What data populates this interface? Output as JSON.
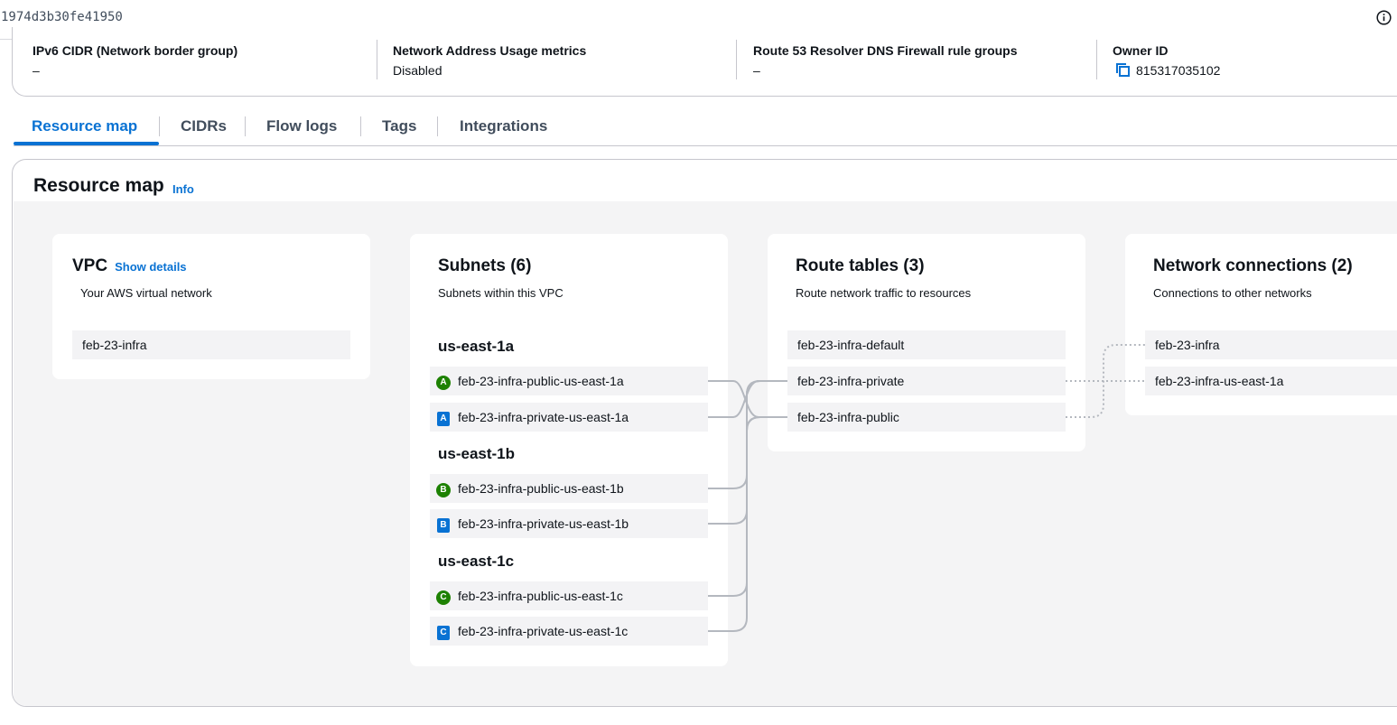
{
  "header": {
    "vpc_id": "1974d3b30fe41950"
  },
  "details": [
    {
      "key": "IPv6 CIDR (Network border group)",
      "value": "–"
    },
    {
      "key": "Network Address Usage metrics",
      "value": "Disabled"
    },
    {
      "key": "Route 53 Resolver DNS Firewall rule groups",
      "value": "–"
    },
    {
      "key": "Owner ID",
      "value": "815317035102"
    }
  ],
  "tabs": [
    {
      "label": "Resource map",
      "active": true
    },
    {
      "label": "CIDRs"
    },
    {
      "label": "Flow logs"
    },
    {
      "label": "Tags"
    },
    {
      "label": "Integrations"
    }
  ],
  "resource_map": {
    "title": "Resource map",
    "info": "Info",
    "vpc": {
      "title": "VPC",
      "link": "Show details",
      "subtitle": "Your AWS virtual network",
      "items": [
        "feb-23-infra"
      ]
    },
    "subnets": {
      "title": "Subnets (6)",
      "subtitle": "Subnets within this VPC",
      "zones": [
        {
          "name": "us-east-1a",
          "public": {
            "badge": "A",
            "name": "feb-23-infra-public-us-east-1a"
          },
          "private": {
            "badge": "A",
            "name": "feb-23-infra-private-us-east-1a"
          }
        },
        {
          "name": "us-east-1b",
          "public": {
            "badge": "B",
            "name": "feb-23-infra-public-us-east-1b"
          },
          "private": {
            "badge": "B",
            "name": "feb-23-infra-private-us-east-1b"
          }
        },
        {
          "name": "us-east-1c",
          "public": {
            "badge": "C",
            "name": "feb-23-infra-public-us-east-1c"
          },
          "private": {
            "badge": "C",
            "name": "feb-23-infra-private-us-east-1c"
          }
        }
      ]
    },
    "route_tables": {
      "title": "Route tables (3)",
      "subtitle": "Route network traffic to resources",
      "items": [
        "feb-23-infra-default",
        "feb-23-infra-private",
        "feb-23-infra-public"
      ]
    },
    "network_connections": {
      "title": "Network connections (2)",
      "subtitle": "Connections to other networks",
      "items": [
        "feb-23-infra",
        "feb-23-infra-us-east-1a"
      ]
    }
  },
  "colors": {
    "accent": "#0972d3",
    "public_badge": "#1d8102",
    "private_badge": "#0972d3",
    "connector": "#b4b8bf"
  }
}
